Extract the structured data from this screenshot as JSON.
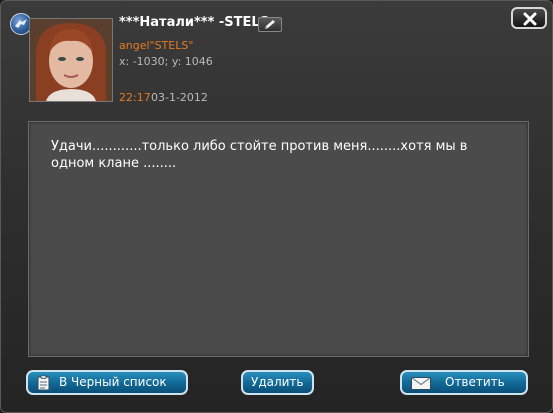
{
  "sender": {
    "name": "***Натали*** -STELS-",
    "clan": "angel\"STELS\"",
    "coords": "x: -1030; y: 1046"
  },
  "message": {
    "time": "22:17",
    "date": "03-1-2012",
    "text": "Удачи............только либо стойте против меня........хотя мы в одном клане ........"
  },
  "buttons": {
    "blacklist": "В Черный список",
    "delete": "Удалить",
    "reply": "Ответить"
  },
  "colors": {
    "accent_orange": "#e67a1f",
    "button_blue": "#126a98"
  },
  "icons": {
    "badge": "eagle-badge-icon",
    "edit": "pencil-icon",
    "close": "close-icon",
    "blacklist": "clipboard-icon",
    "reply": "envelope-icon"
  }
}
